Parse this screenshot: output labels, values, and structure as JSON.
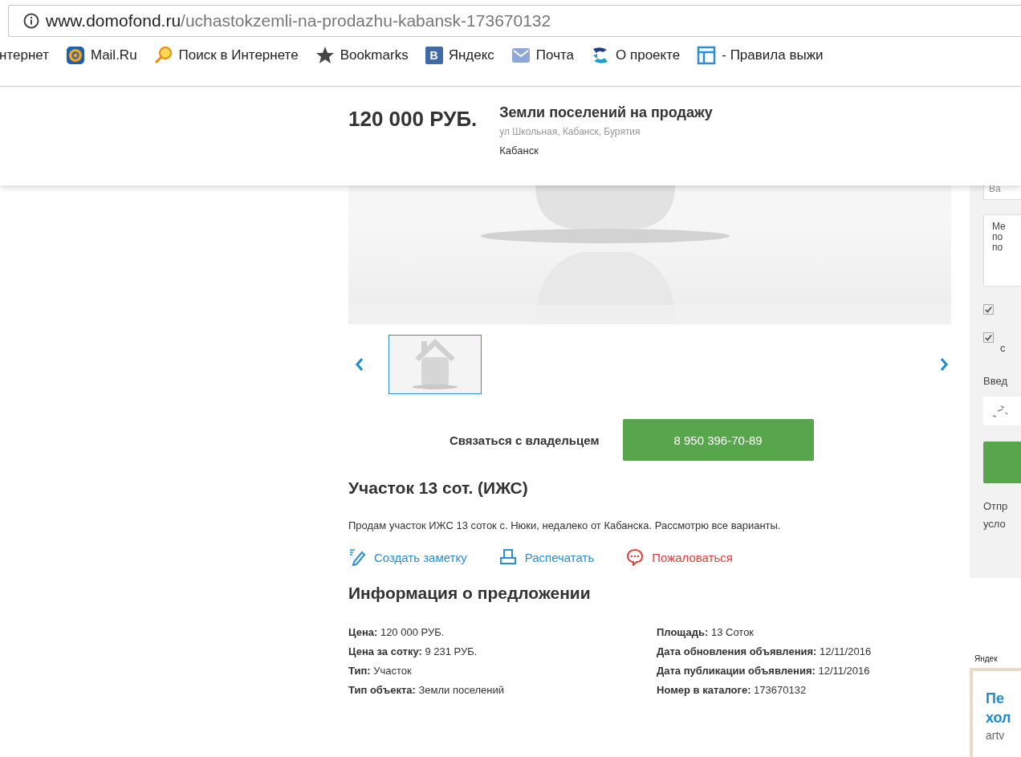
{
  "browser": {
    "url_host": "www.domofond.ru",
    "url_path": "/uchastokzemli-na-prodazhu-kabansk-173670132",
    "bookmarks": [
      {
        "kind": "plain",
        "label": "нтернет"
      },
      {
        "kind": "mail",
        "label": "Mail.Ru"
      },
      {
        "kind": "search",
        "label": "Поиск в Интернете"
      },
      {
        "kind": "star",
        "label": "Bookmarks"
      },
      {
        "kind": "letter",
        "badge": "В",
        "label": "Яндекс"
      },
      {
        "kind": "envelope",
        "label": "Почта"
      },
      {
        "kind": "swirl",
        "label": "О проекте"
      },
      {
        "kind": "layout",
        "label": "- Правила выжи"
      }
    ]
  },
  "header": {
    "price": "120 000 РУБ.",
    "title": "Земли поселений на продажу",
    "address": "ул Школьная, Кабанск, Бурятия",
    "city": "Кабанск"
  },
  "gallery": {
    "thumbnails": [
      {
        "selected": true
      }
    ]
  },
  "contact": {
    "label": "Связаться с владельцем",
    "phone": "8 950 396-70-89"
  },
  "listing": {
    "title": "Участок 13 сот. (ИЖС)",
    "description": "Продам участок ИЖС 13 соток с. Нюки, недалеко от Кабанска. Рассмотрю все варианты.",
    "actions": [
      {
        "kind": "note",
        "label": "Создать заметку"
      },
      {
        "kind": "print",
        "label": "Распечатать"
      },
      {
        "kind": "report",
        "label": "Пожаловаться"
      }
    ]
  },
  "info": {
    "title": "Информация о предложении",
    "left": [
      {
        "label": "Цена:",
        "value": "120 000 РУБ."
      },
      {
        "label": "Цена за сотку:",
        "value": "9 231 РУБ."
      },
      {
        "label": "Тип:",
        "value": "Участок"
      },
      {
        "label": "Тип объекта:",
        "value": "Земли поселений"
      }
    ],
    "right": [
      {
        "label": "Площадь:",
        "value": "13 Соток"
      },
      {
        "label": "Дата обновления объявления:",
        "value": "12/11/2016"
      },
      {
        "label": "Дата публикации объявления:",
        "value": "12/11/2016"
      },
      {
        "label": "Номер в каталоге:",
        "value": "173670132"
      }
    ]
  },
  "side_form": {
    "input_value": "Ba",
    "message_lines": [
      "Me",
      "по",
      "по"
    ],
    "checkboxes": [
      {
        "checked": true
      },
      {
        "checked": true,
        "label": "с"
      }
    ],
    "captcha_label": "Введ",
    "note_lines": [
      "Отпр",
      "усло"
    ]
  },
  "ad": {
    "label": "Яндек",
    "title_lines": [
      "Пе",
      "хол"
    ],
    "domain": "artv"
  }
}
